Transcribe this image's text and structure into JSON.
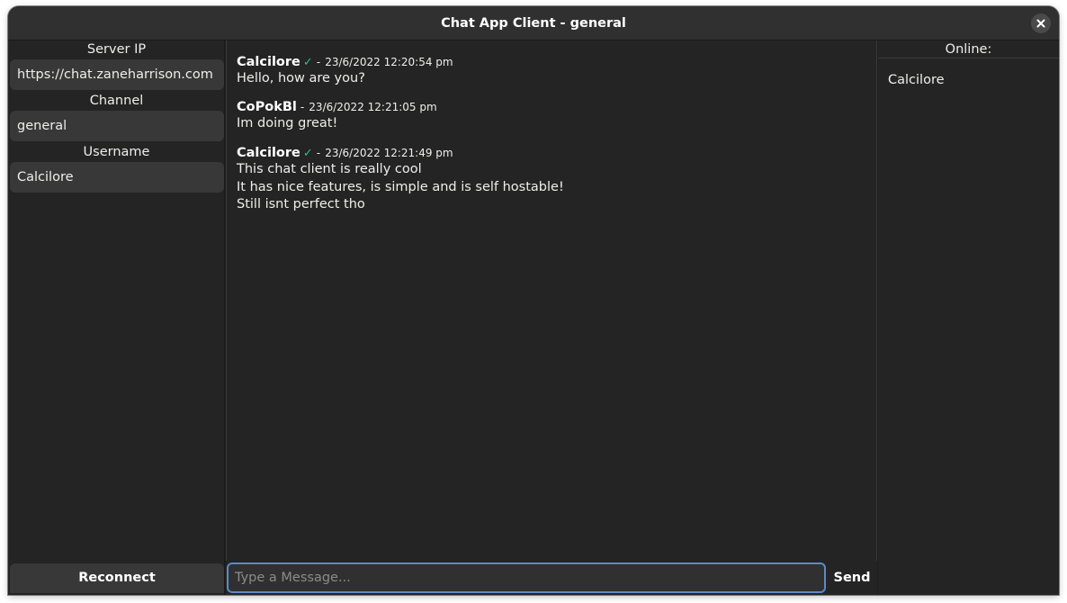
{
  "window": {
    "title": "Chat App Client - general"
  },
  "sidebar": {
    "server_ip_label": "Server IP",
    "server_ip_value": "https://chat.zaneharrison.com",
    "channel_label": "Channel",
    "channel_value": "general",
    "username_label": "Username",
    "username_value": "Calcilore",
    "reconnect_label": "Reconnect"
  },
  "messages": [
    {
      "user": "Calcilore",
      "verified": true,
      "separator": "-",
      "time": "23/6/2022 12:20:54 pm",
      "lines": [
        "Hello, how are you?"
      ]
    },
    {
      "user": "CoPokBl",
      "verified": false,
      "separator": "-",
      "time": "23/6/2022 12:21:05 pm",
      "lines": [
        "Im doing great!"
      ]
    },
    {
      "user": "Calcilore",
      "verified": true,
      "separator": "-",
      "time": "23/6/2022 12:21:49 pm",
      "lines": [
        "This chat client is really cool",
        "It has nice features, is simple and is self hostable!",
        "Still isnt perfect tho"
      ]
    }
  ],
  "composer": {
    "placeholder": "Type a Message...",
    "value": "",
    "send_label": "Send"
  },
  "online": {
    "header": "Online:",
    "users": [
      "Calcilore"
    ]
  },
  "colors": {
    "background": "#242424",
    "entry": "#383838",
    "focus_border": "#5b8ac6",
    "verified_check": "#2ec27e"
  },
  "icons": {
    "close": "close-icon",
    "verified": "checkmark-icon"
  }
}
